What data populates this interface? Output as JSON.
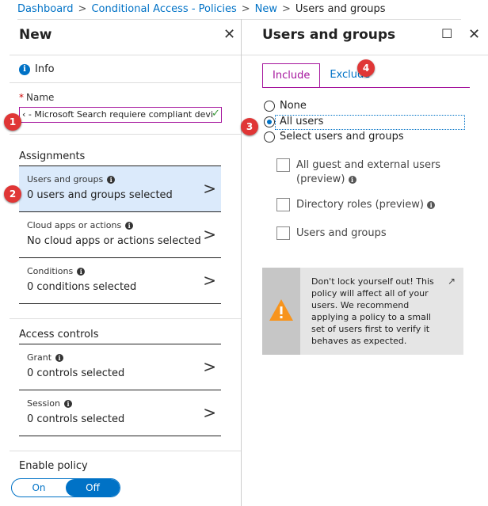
{
  "breadcrumb": [
    "Dashboard",
    "Conditional Access - Policies",
    "New",
    "Users and groups"
  ],
  "left_blade": {
    "title": "New",
    "close_icon": "close-icon",
    "info_label": "Info",
    "name_label": "Name",
    "name_value": "‹ - Microsoft Search requiere compliant devi",
    "assignments_title": "Assignments",
    "rows": [
      {
        "label": "Users and groups",
        "value": "0 users and groups selected"
      },
      {
        "label": "Cloud apps or actions",
        "value": "No cloud apps or actions selected"
      },
      {
        "label": "Conditions",
        "value": "0 conditions selected"
      }
    ],
    "access_controls_title": "Access controls",
    "control_rows": [
      {
        "label": "Grant",
        "value": "0 controls selected"
      },
      {
        "label": "Session",
        "value": "0 controls selected"
      }
    ],
    "enable_policy_title": "Enable policy",
    "toggle": {
      "on": "On",
      "off": "Off",
      "selected": "Off"
    }
  },
  "right_blade": {
    "title": "Users and groups",
    "tabs": [
      "Include",
      "Exclude"
    ],
    "active_tab": "Include",
    "radios": [
      "None",
      "All users",
      "Select users and groups"
    ],
    "selected_radio": "All users",
    "checkboxes": [
      "All guest and external users (preview)",
      "Directory roles (preview)",
      "Users and groups"
    ],
    "callout_text": "Don't lock yourself out! This policy will affect all of your users. We recommend applying a policy to a small set of users first to verify it behaves as expected."
  },
  "badges": [
    "1",
    "2",
    "3",
    "4"
  ],
  "colors": {
    "accent": "#0072c6",
    "tab_active": "#a5159d",
    "badge": "#e03636",
    "selected_row": "#dbeafb",
    "warning": "#f7941d"
  }
}
